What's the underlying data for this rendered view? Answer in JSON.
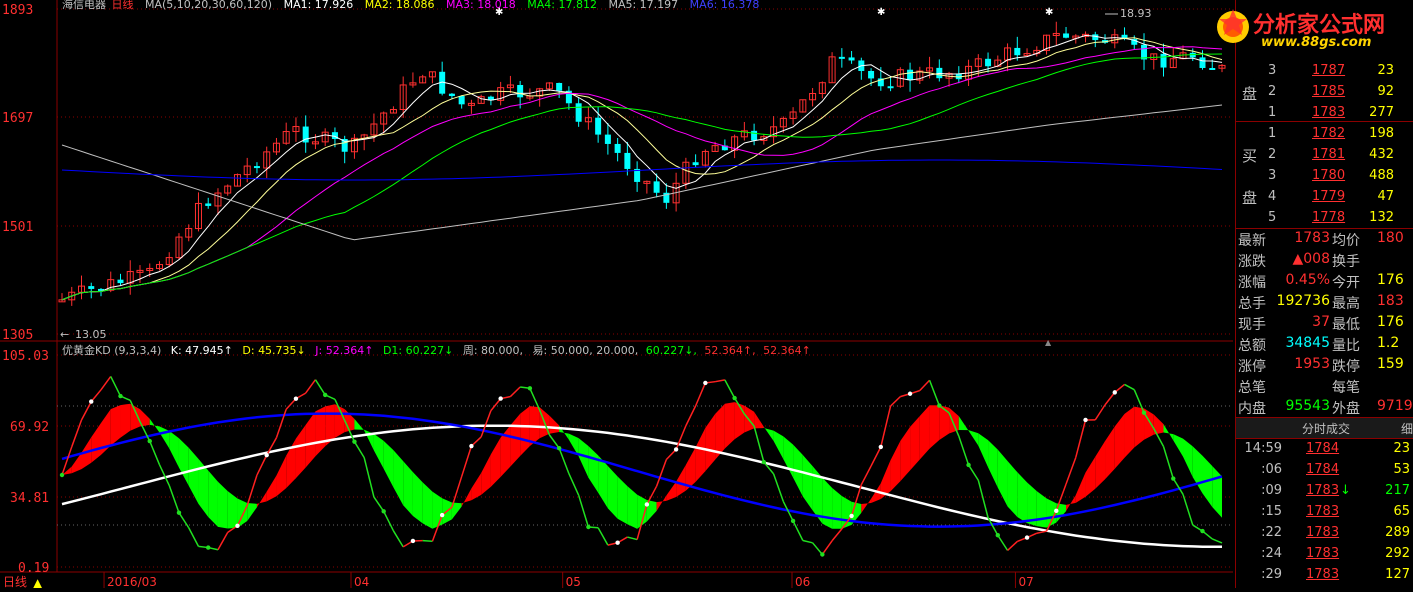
{
  "main_header": {
    "stock_name": "海信电器",
    "period": "日线",
    "ma_params": "MA(5,10,20,30,60,120)",
    "ma_values": [
      {
        "label": "MA1: 17.926",
        "color": "#ffffff"
      },
      {
        "label": "MA2: 18.086",
        "color": "#ffff00"
      },
      {
        "label": "MA3: 18.018",
        "color": "#ff00ff"
      },
      {
        "label": "MA4: 17.812",
        "color": "#00ff00"
      },
      {
        "label": "MA5: 17.197",
        "color": "#c0c0c0"
      },
      {
        "label": "MA6: 16.378",
        "color": "#0000ff"
      }
    ]
  },
  "y_axis_labels": [
    "1893",
    "1697",
    "1501",
    "1305"
  ],
  "max_marker": "18.93",
  "min_marker": "13.05",
  "indicator_header": {
    "name": "优黄金KD",
    "params": "(9,3,3,4)",
    "items": [
      {
        "label": "K: 47.945↑",
        "color": "#ffffff"
      },
      {
        "label": "D: 45.735↓",
        "color": "#ffff00"
      },
      {
        "label": "J: 52.364↑",
        "color": "#ff00ff"
      },
      {
        "label": "D1: 60.227↓",
        "color": "#00ff00"
      },
      {
        "label": "周: 80.000,",
        "color": "#c0c0c0"
      },
      {
        "label": "易: 50.000, 20.000,",
        "color": "#c0c0c0"
      },
      {
        "label": "60.227↓,",
        "color": "#00ff00"
      },
      {
        "label": "52.364↑,",
        "color": "#ff3030"
      },
      {
        "label": "52.364↑",
        "color": "#ff3030"
      }
    ]
  },
  "indicator_axis_labels": [
    "105.03",
    "69.92",
    "34.81",
    "0.19"
  ],
  "x_axis": {
    "period_tab": "日线",
    "months": [
      {
        "label": "2016/03",
        "frac": 0.04
      },
      {
        "label": "04",
        "frac": 0.25
      },
      {
        "label": "05",
        "frac": 0.43
      },
      {
        "label": "06",
        "frac": 0.625
      },
      {
        "label": "07",
        "frac": 0.815
      }
    ]
  },
  "logo": {
    "line1": "分析家公式网",
    "line2": "www.88gs.com"
  },
  "order_book": {
    "sell_label": [
      "盘"
    ],
    "buy_label": [
      "买",
      "盘"
    ],
    "sell": [
      {
        "level": "3",
        "price": "1787",
        "vol": "23"
      },
      {
        "level": "2",
        "price": "1785",
        "vol": "92"
      },
      {
        "level": "1",
        "price": "1783",
        "vol": "277"
      }
    ],
    "buy": [
      {
        "level": "1",
        "price": "1782",
        "vol": "198"
      },
      {
        "level": "2",
        "price": "1781",
        "vol": "432"
      },
      {
        "level": "3",
        "price": "1780",
        "vol": "488"
      },
      {
        "level": "4",
        "price": "1779",
        "vol": "47"
      },
      {
        "level": "5",
        "price": "1778",
        "vol": "132"
      }
    ]
  },
  "quote_stats": [
    {
      "l1": "最新",
      "v1": "1783",
      "c1": "#ff3030",
      "l2": "均价",
      "v2": "180",
      "c2": "#ff3030"
    },
    {
      "l1": "涨跌",
      "v1": "▲008",
      "c1": "#ff3030",
      "l2": "换手",
      "v2": "",
      "c2": "#ffff00"
    },
    {
      "l1": "涨幅",
      "v1": "0.45%",
      "c1": "#ff3030",
      "l2": "今开",
      "v2": "176",
      "c2": "#ffff00"
    },
    {
      "l1": "总手",
      "v1": "192736",
      "c1": "#ffff00",
      "l2": "最高",
      "v2": "183",
      "c2": "#ff3030"
    },
    {
      "l1": "现手",
      "v1": "37",
      "c1": "#ff3030",
      "l2": "最低",
      "v2": "176",
      "c2": "#ffff00"
    },
    {
      "l1": "总额",
      "v1": "34845",
      "c1": "#00ffff",
      "l2": "量比",
      "v2": "1.2",
      "c2": "#ffff00"
    },
    {
      "l1": "涨停",
      "v1": "1953",
      "c1": "#ff3030",
      "l2": "跌停",
      "v2": "159",
      "c2": "#ffff00"
    },
    {
      "l1": "总笔",
      "v1": "",
      "c1": "#c0c0c0",
      "l2": "每笔",
      "v2": "",
      "c2": "#ffff00"
    },
    {
      "l1": "内盘",
      "v1": "95543",
      "c1": "#00ff00",
      "l2": "外盘",
      "v2": "9719",
      "c2": "#ff3030"
    }
  ],
  "trades_header": {
    "tab1": "分时成交",
    "tab2": "细"
  },
  "trades": [
    {
      "time": "14:59",
      "price": "1784",
      "vol": "23",
      "pc": "#ff3030",
      "vc": "#ffff00",
      "arrow": ""
    },
    {
      "time": ":06",
      "price": "1784",
      "vol": "53",
      "pc": "#ff3030",
      "vc": "#ffff00",
      "arrow": ""
    },
    {
      "time": ":09",
      "price": "1783",
      "vol": "217",
      "pc": "#ff3030",
      "vc": "#00ff00",
      "arrow": "↓"
    },
    {
      "time": ":15",
      "price": "1783",
      "vol": "65",
      "pc": "#ff3030",
      "vc": "#ffff00",
      "arrow": ""
    },
    {
      "time": ":22",
      "price": "1783",
      "vol": "289",
      "pc": "#ff3030",
      "vc": "#ffff00",
      "arrow": ""
    },
    {
      "time": ":24",
      "price": "1783",
      "vol": "292",
      "pc": "#ff3030",
      "vc": "#ffff00",
      "arrow": ""
    },
    {
      "time": ":29",
      "price": "1783",
      "vol": "127",
      "pc": "#ff3030",
      "vc": "#ffff00",
      "arrow": ""
    }
  ],
  "colors": {
    "border": "#8b0000",
    "axis_text": "#ff3030",
    "up_candle": "#ff3030",
    "down_candle": "#00ffff",
    "kd_red": "#ff0000",
    "kd_green": "#00ff00",
    "kd_white": "#ffffff",
    "kd_blue": "#0000ff"
  }
}
